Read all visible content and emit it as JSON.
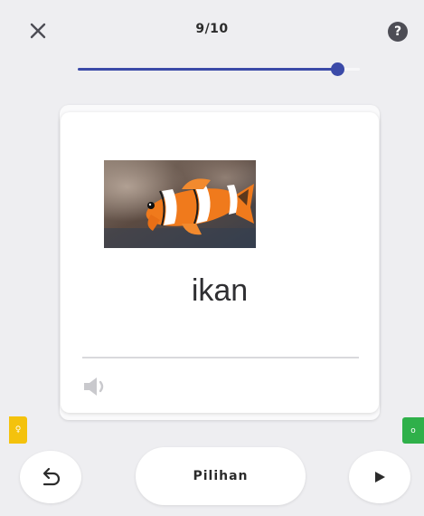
{
  "header": {
    "counter_text": "9/10",
    "close_icon": "close-icon",
    "help_icon": "help-icon"
  },
  "progress": {
    "current": 9,
    "total": 10,
    "fraction": 0.92,
    "color": "#3b4aa8"
  },
  "card": {
    "word": "ikan",
    "image_subject": "clownfish",
    "audio_icon": "speaker-icon"
  },
  "side_tabs": {
    "left_label": "♀",
    "right_label": "o",
    "left_color": "#f4c20d",
    "right_color": "#2fb04a"
  },
  "bottom_bar": {
    "undo_icon": "undo-icon",
    "options_label": "Pilihan",
    "play_icon": "play-icon"
  }
}
